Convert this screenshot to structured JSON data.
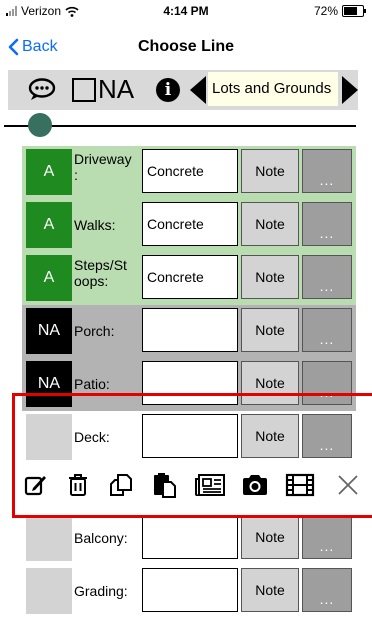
{
  "status_bar": {
    "carrier": "Verizon",
    "time": "4:14 PM",
    "battery": "72%",
    "battery_level": 0.72
  },
  "nav": {
    "back_label": "Back",
    "title": "Choose Line"
  },
  "toolbar": {
    "na_label": "NA",
    "section": "Lots and Grounds"
  },
  "slider": {
    "value": 0.08
  },
  "rows": [
    {
      "grade": "A",
      "label": "Driveway\n:",
      "value": "Concrete",
      "note": "Note",
      "more": "...",
      "style": "green"
    },
    {
      "grade": "A",
      "label": "Walks:",
      "value": "Concrete",
      "note": "Note",
      "more": "...",
      "style": "green"
    },
    {
      "grade": "A",
      "label": "Steps/St\noops:",
      "value": "Concrete",
      "note": "Note",
      "more": "...",
      "style": "green"
    },
    {
      "grade": "NA",
      "label": "Porch:",
      "value": "",
      "note": "Note",
      "more": "...",
      "style": "gray"
    },
    {
      "grade": "NA",
      "label": "Patio:",
      "value": "",
      "note": "Note",
      "more": "...",
      "style": "gray"
    },
    {
      "grade": "",
      "label": "Deck:",
      "value": "",
      "note": "Note",
      "more": "...",
      "style": "white"
    },
    {
      "grade": "",
      "label": "Balcony:",
      "value": "",
      "note": "Note",
      "more": "...",
      "style": "white"
    },
    {
      "grade": "",
      "label": "Grading:",
      "value": "",
      "note": "Note",
      "more": "...",
      "style": "white"
    }
  ],
  "action_icons": [
    "edit-icon",
    "trash-icon",
    "copy-icon",
    "paste-icon",
    "newspaper-icon",
    "camera-icon",
    "film-icon",
    "close-icon"
  ],
  "colors": {
    "accent": "#0a6cf7",
    "green_row": "#b9ddb0",
    "grade_green": "#1f8a1f",
    "gray_row": "#b3b3b3",
    "highlight": "#e30000",
    "slider_thumb": "#37705f"
  }
}
